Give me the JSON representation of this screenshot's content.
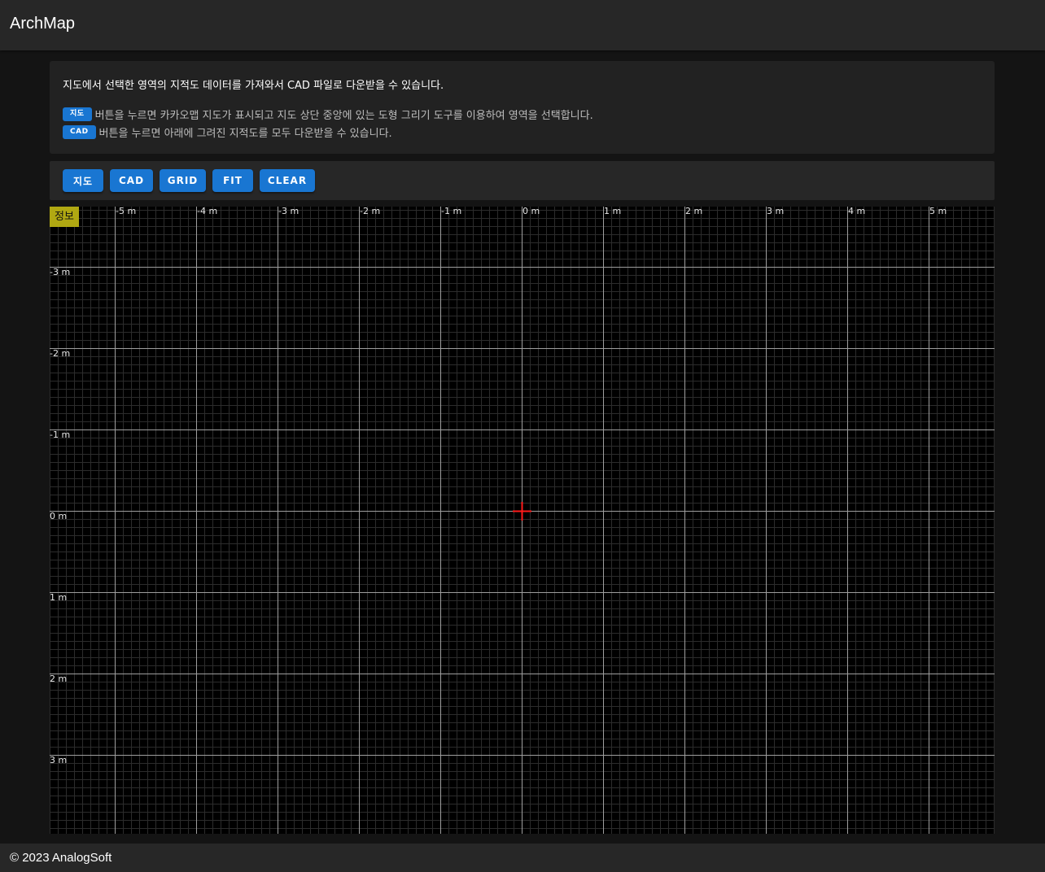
{
  "header": {
    "title": "ArchMap"
  },
  "info": {
    "line1": "지도에서 선택한 영역의 지적도 데이터를 가져와서 CAD 파일로 다운받을 수 있습니다.",
    "map_chip": "지도",
    "map_text": "버튼을 누르면 카카오맵 지도가 표시되고 지도 상단 중앙에 있는 도형 그리기 도구를 이용하여 영역을 선택합니다.",
    "cad_chip": "CAD",
    "cad_text": "버튼을 누르면 아래에 그려진 지적도를 모두 다운받을 수 있습니다."
  },
  "toolbar": {
    "map_label": "지도",
    "cad_label": "CAD",
    "grid_label": "GRID",
    "fit_label": "FIT",
    "clear_label": "CLEAR"
  },
  "canvas": {
    "info_badge": "정보",
    "x_labels": [
      "-5 m",
      "-4 m",
      "-3 m",
      "-2 m",
      "-1 m",
      "0 m",
      "1 m",
      "2 m",
      "3 m",
      "4 m",
      "5 m"
    ],
    "y_labels": [
      "-3 m",
      "-2 m",
      "-1 m",
      "0 m",
      "1 m",
      "2 m",
      "3 m"
    ],
    "origin_marker_color": "#ff1a1a",
    "major_line_color": "#9e9e9e",
    "minor_line_color": "#2c2c2c"
  },
  "footer": {
    "copyright": "© 2023 AnalogSoft"
  }
}
